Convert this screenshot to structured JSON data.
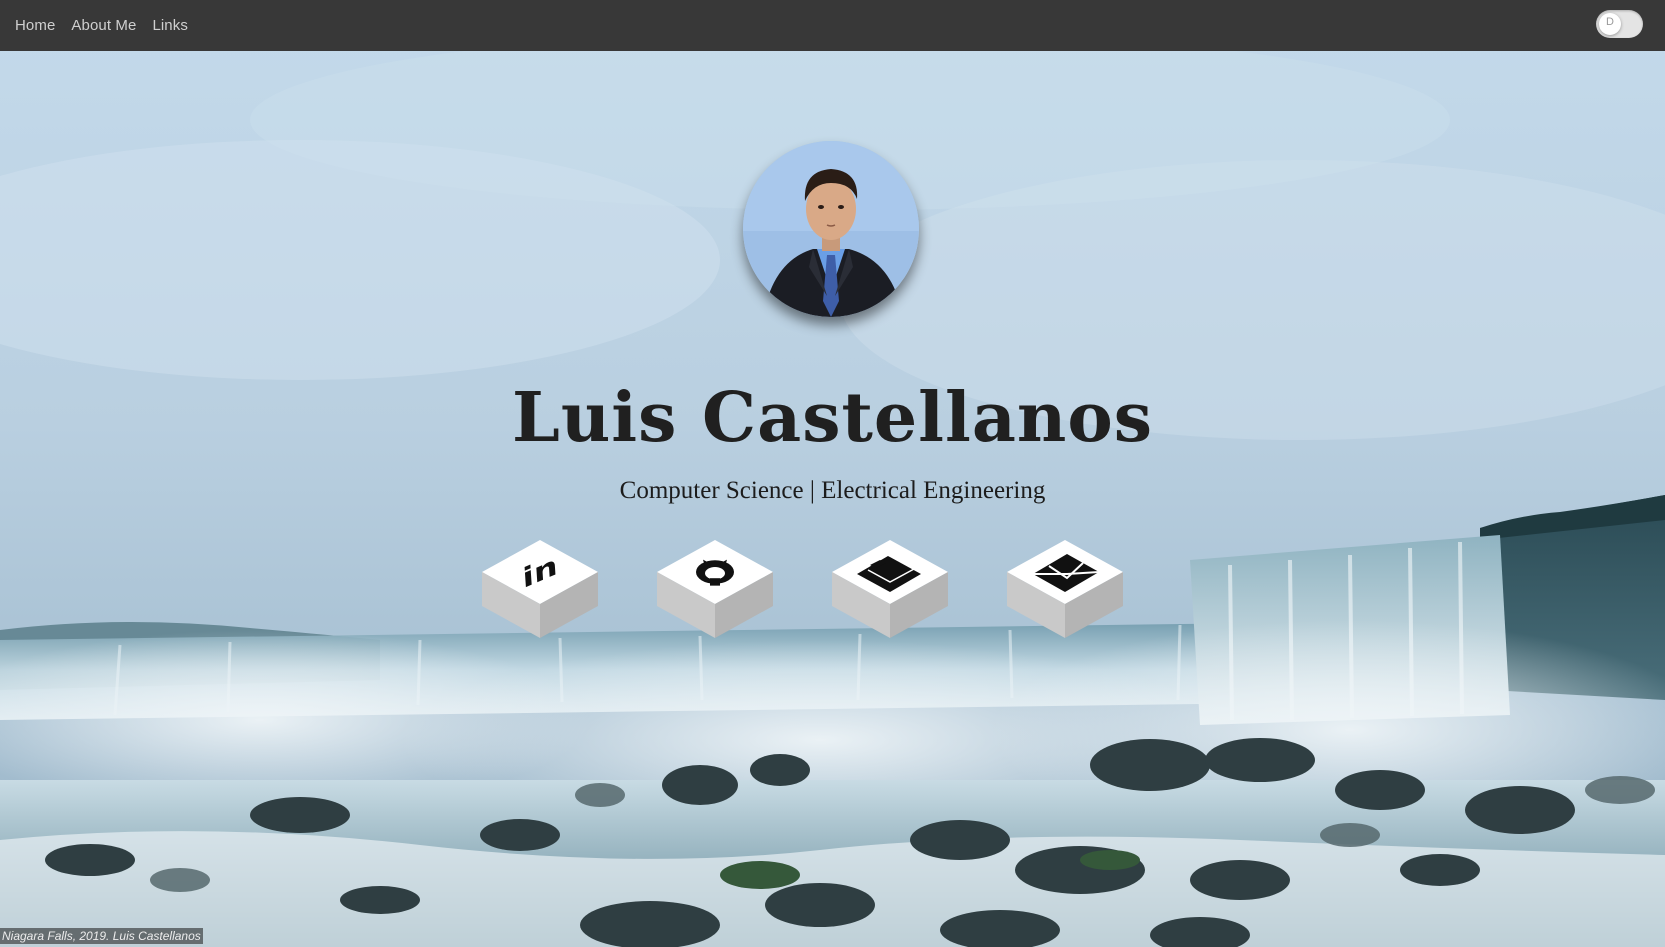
{
  "nav": {
    "links": [
      "Home",
      "About Me",
      "Links"
    ],
    "theme_toggle_letter": "D"
  },
  "hero": {
    "name": "Luis Castellanos",
    "subtitle": "Computer Science | Electrical Engineering"
  },
  "social": [
    {
      "icon": "linkedin-icon"
    },
    {
      "icon": "github-icon"
    },
    {
      "icon": "folder-icon"
    },
    {
      "icon": "envelope-icon"
    }
  ],
  "caption": "Niagara Falls, 2019. Luis Castellanos",
  "colors": {
    "navbar": "#383838",
    "nav_text": "#cfcfcf",
    "title": "#202020",
    "tile_top": "#ffffff",
    "tile_side": "#c8c8c8"
  }
}
